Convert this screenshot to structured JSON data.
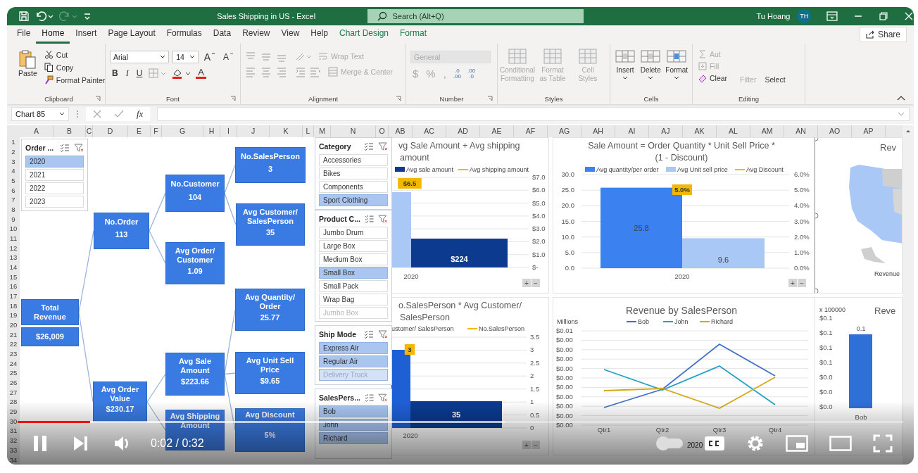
{
  "title_bar": {
    "quick_access": [
      {
        "kind": "save",
        "disabled": false
      },
      {
        "kind": "undo",
        "disabled": false
      },
      {
        "kind": "redo",
        "disabled": true
      },
      {
        "kind": "customize",
        "disabled": false
      }
    ],
    "title": "Sales Shipping in US  -  Excel",
    "search": {
      "placeholder": "Search (Alt+Q)"
    },
    "user_name": "Tu Hoang",
    "avatar_initials": "TH"
  },
  "ribbon_tabs": [
    {
      "label": "File",
      "selected": false,
      "contextual": false
    },
    {
      "label": "Home",
      "selected": true,
      "contextual": false
    },
    {
      "label": "Insert",
      "selected": false,
      "contextual": false
    },
    {
      "label": "Page Layout",
      "selected": false,
      "contextual": false
    },
    {
      "label": "Formulas",
      "selected": false,
      "contextual": false
    },
    {
      "label": "Data",
      "selected": false,
      "contextual": false
    },
    {
      "label": "Review",
      "selected": false,
      "contextual": false
    },
    {
      "label": "View",
      "selected": false,
      "contextual": false
    },
    {
      "label": "Help",
      "selected": false,
      "contextual": false
    },
    {
      "label": "Chart Design",
      "selected": false,
      "contextual": true
    },
    {
      "label": "Format",
      "selected": false,
      "contextual": true
    }
  ],
  "share_button": "Share",
  "ribbon": {
    "clipboard": {
      "label": "Clipboard",
      "paste": "Paste",
      "commands": [
        "Cut",
        "Copy",
        "Format Painter"
      ]
    },
    "font": {
      "label": "Font",
      "family": "Arial",
      "size": "14",
      "grow": "A",
      "shrink": "A",
      "styles": [
        "B",
        "I",
        "U"
      ],
      "font_color": "A"
    },
    "alignment": {
      "label": "Alignment",
      "commands": [
        {
          "label": "Wrap Text",
          "disabled": true
        },
        {
          "label": "Merge & Center",
          "disabled": true
        }
      ]
    },
    "number": {
      "label": "Number",
      "format": "General",
      "format_disabled": true,
      "symbols": [
        "$",
        "%",
        ","
      ],
      "decimals": [
        {
          "top": ".0",
          "bottom": ".00"
        },
        {
          "top": ".00",
          "bottom": ".0"
        }
      ]
    },
    "styles": {
      "label": "Styles",
      "commands": [
        {
          "label": "Conditional Formatting",
          "disabled": true
        },
        {
          "label": "Format as Table",
          "disabled": true
        },
        {
          "label": "Cell Styles",
          "disabled": true
        }
      ]
    },
    "cells": {
      "label": "Cells",
      "commands": [
        {
          "label": "Insert",
          "disabled": false
        },
        {
          "label": "Delete",
          "disabled": false
        },
        {
          "label": "Format",
          "disabled": false
        }
      ]
    },
    "editing": {
      "label": "Editing",
      "commands": [
        {
          "label": "Aut",
          "disabled": true
        },
        {
          "label": "Fill",
          "disabled": true
        },
        {
          "label": "Clear",
          "disabled": false
        },
        {
          "label": "Filter",
          "disabled": true
        },
        {
          "label": "Select",
          "disabled": false
        }
      ]
    }
  },
  "formula_bar": {
    "name_box": "Chart 85",
    "function_label": "fx"
  },
  "sheet": {
    "columns": [
      "A",
      "B",
      "C",
      "D",
      "E",
      "F",
      "G",
      "H",
      "I",
      "J",
      "K",
      "L",
      "M",
      "N",
      "O",
      "AB",
      "AC",
      "AD",
      "AE",
      "AF",
      "AG",
      "AH",
      "AI",
      "AJ",
      "AK",
      "AL",
      "AM",
      "AN",
      "AO",
      "AP"
    ],
    "rows": [
      "1",
      "2",
      "3",
      "4",
      "5",
      "6",
      "7",
      "8",
      "9",
      "10",
      "11",
      "12",
      "13",
      "14",
      "15",
      "16",
      "17",
      "18",
      "19",
      "20",
      "21",
      "22",
      "23",
      "24",
      "25",
      "26",
      "27",
      "28",
      "29",
      "30",
      "31",
      "32",
      "33",
      "34"
    ]
  },
  "slicers": [
    {
      "title": "Order ...",
      "items": [
        {
          "label": "2020",
          "selected": true,
          "disabled": false
        },
        {
          "label": "2021",
          "selected": false,
          "disabled": false
        },
        {
          "label": "2022",
          "selected": false,
          "disabled": false
        },
        {
          "label": "2023",
          "selected": false,
          "disabled": false
        }
      ]
    },
    {
      "title": "Category",
      "items": [
        {
          "label": "Accessories",
          "selected": false,
          "disabled": false
        },
        {
          "label": "Bikes",
          "selected": false,
          "disabled": false
        },
        {
          "label": "Components",
          "selected": false,
          "disabled": false
        },
        {
          "label": "Sport Clothing",
          "selected": true,
          "disabled": false
        }
      ]
    },
    {
      "title": "Product C...",
      "items": [
        {
          "label": "Jumbo Drum",
          "selected": false,
          "disabled": false
        },
        {
          "label": "Large Box",
          "selected": false,
          "disabled": false
        },
        {
          "label": "Medium Box",
          "selected": false,
          "disabled": false
        },
        {
          "label": "Small Box",
          "selected": true,
          "disabled": false
        },
        {
          "label": "Small Pack",
          "selected": false,
          "disabled": false
        },
        {
          "label": "Wrap Bag",
          "selected": false,
          "disabled": false
        },
        {
          "label": "Jumbo Box",
          "selected": false,
          "disabled": true
        }
      ]
    },
    {
      "title": "Ship Mode",
      "items": [
        {
          "label": "Express Air",
          "selected": true,
          "disabled": false
        },
        {
          "label": "Regular Air",
          "selected": true,
          "disabled": false
        },
        {
          "label": "Delivery Truck",
          "selected": true,
          "disabled": true
        }
      ]
    },
    {
      "title": "SalesPers...",
      "items": [
        {
          "label": "Bob",
          "selected": true,
          "disabled": false
        },
        {
          "label": "John",
          "selected": true,
          "disabled": false
        },
        {
          "label": "Richard",
          "selected": true,
          "disabled": false
        }
      ]
    }
  ],
  "tree": {
    "kind": "total",
    "label": "Total Revenue",
    "value": "$26,009",
    "children": [
      {
        "kind": "metric",
        "label": "No.Order",
        "value": "113",
        "children": [
          {
            "kind": "metric",
            "label": "No.Customer",
            "value": "104",
            "children": [
              {
                "kind": "metric",
                "label": "No.SalesPerson",
                "value": "3"
              },
              {
                "kind": "metric",
                "label": "Avg Customer/ SalesPerson",
                "value": "35"
              }
            ]
          },
          {
            "kind": "metric",
            "label": "Avg Order/ Customer",
            "value": "1.09"
          }
        ]
      },
      {
        "kind": "metric",
        "label": "Avg Order Value",
        "value": "$230.17",
        "children": [
          {
            "kind": "metric",
            "label": "Avg Sale Amount",
            "value": "$223.66",
            "children": [
              {
                "kind": "metric",
                "label": "Avg Quantity/ Order",
                "value": "25.77"
              },
              {
                "kind": "metric",
                "label": "Avg Unit Sell Price",
                "value": "$9.65"
              },
              {
                "kind": "metric",
                "label": "Avg Discount",
                "value": "5%"
              }
            ]
          },
          {
            "kind": "metric",
            "label": "Avg Shipping Amount"
          }
        ]
      }
    ]
  },
  "charts": [
    {
      "kind": "combo",
      "title_lines": [
        "vg Sale Amount + Avg shipping",
        "amount"
      ],
      "legend": [
        {
          "name": "Avg sale amount",
          "color": "#0b3a8f",
          "kind": "bar"
        },
        {
          "name": "Avg shipping amount",
          "color": "#f2b800",
          "kind": "line"
        }
      ],
      "axis_labels": [
        "$7.0",
        "$6.0",
        "$5.0",
        "$4.0",
        "$3.0",
        "$2.0",
        "$1.0",
        "$-"
      ],
      "bars": [
        {
          "color": "#a9c8f5"
        },
        {
          "color": "#0b3a8f",
          "label": "$224"
        }
      ],
      "tags": [
        {
          "label": "$6.5"
        }
      ],
      "category": "2020",
      "buttons": [
        "+",
        "−"
      ]
    },
    {
      "kind": "bar",
      "title_lines": [
        "Sale Amount = Order Quantity * Unit Sell Price *",
        "(1 - Discount)"
      ],
      "discount": {
        "name": "Avg Discount",
        "color": "#f2b800",
        "label": "5.0%"
      },
      "secondary_ticks": [
        "6.0%",
        "5.0%",
        "4.0%",
        "3.0%",
        "2.0%",
        "1.0%",
        "0.0%"
      ],
      "buttons": [
        "+",
        "−"
      ],
      "chart_data": {
        "type": "bar",
        "categories": [
          "2020"
        ],
        "series": [
          {
            "name": "Avg quantity/per order",
            "color": "#3b82f0",
            "values": [
              25.8
            ]
          },
          {
            "name": "Avg Unit sell price",
            "color": "#a9c8f5",
            "values": [
              9.6
            ]
          }
        ],
        "ylim": [
          0,
          30
        ],
        "yticks": [
          {
            "value": 0,
            "label": "0.0"
          },
          {
            "value": 5,
            "label": "5.0"
          },
          {
            "value": 10,
            "label": "10.0"
          },
          {
            "value": 15,
            "label": "15.0"
          },
          {
            "value": 20,
            "label": "20.0"
          },
          {
            "value": 25,
            "label": "25.0"
          },
          {
            "value": 30,
            "label": "30.0"
          }
        ],
        "data_labels": true,
        "grid": true,
        "legend": "top"
      }
    },
    {
      "kind": "map",
      "title": "Rev",
      "legend_label": "Revenue"
    },
    {
      "kind": "combo",
      "title_lines": [
        "o.SalesPerson * Avg Customer/",
        "SalesPerson"
      ],
      "legend": [
        {
          "name": "ustomer/ SalesPerson",
          "kind": "none"
        },
        {
          "name": "No.SalesPerson",
          "color": "#f2b800",
          "kind": "line"
        }
      ],
      "axis_labels": [
        "3.5",
        "3",
        "2.5",
        "2",
        "1.5",
        "1",
        "0.5",
        "0"
      ],
      "bars": [
        {
          "color": "#1f5fd6"
        },
        {
          "color": "#0b3a8f",
          "label": "35"
        }
      ],
      "tags": [
        {
          "label": "3"
        }
      ],
      "category": "2020",
      "buttons": [
        "+",
        "−"
      ]
    },
    {
      "kind": "line",
      "title": "Revenue by SalesPerson",
      "unit_label": "Millions",
      "legend": [
        {
          "name": "Bob",
          "color": "#3f6fc6"
        },
        {
          "name": "John",
          "color": "#22a0c8"
        },
        {
          "name": "Richard",
          "color": "#d4a916"
        }
      ],
      "y_labels": [
        "$0.01",
        "$0.00",
        "$0.00",
        "$0.00",
        "$0.00",
        "$0.00",
        "$0.00",
        "$0.00",
        "$0.00",
        "$0.00",
        "$0.00"
      ],
      "categories": [
        "Qtr1",
        "Qtr2",
        "Qtr3",
        "Qtr4"
      ],
      "note": "2020"
    },
    {
      "kind": "column",
      "title": "Reve",
      "unit_label": "x 100000",
      "y_labels": [
        "$0.1",
        "$0.1",
        "$0.1",
        "$0.1",
        "$0.0",
        "$0.0",
        "$0.0"
      ],
      "bar_label": "0.1",
      "category": "Bob"
    }
  ],
  "video_player": {
    "progress": {
      "level": 0.082
    },
    "buffered": {
      "level": 0.55
    },
    "time": "0:02 / 0:32",
    "playing": true,
    "autoplay": false,
    "captions": false
  }
}
